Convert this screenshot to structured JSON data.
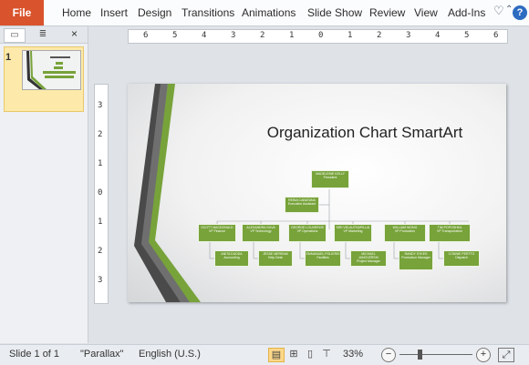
{
  "ribbon": {
    "file_label": "File",
    "tabs": [
      "Home",
      "Insert",
      "Design",
      "Transitions",
      "Animations",
      "Slide Show",
      "Review",
      "View",
      "Add-Ins"
    ],
    "icons": [
      "heart-icon",
      "chevron-up-icon",
      "help-icon"
    ],
    "help_label": "?"
  },
  "left_pane": {
    "tab_icons": [
      "slides-tab-icon",
      "outline-tab-icon"
    ],
    "close_label": "×",
    "thumbnail_number": "1"
  },
  "ruler": {
    "horizontal_labels": [
      "6",
      "5",
      "4",
      "3",
      "2",
      "1",
      "0",
      "1",
      "2",
      "3",
      "4",
      "5",
      "6"
    ],
    "vertical_labels": [
      "3",
      "2",
      "1",
      "0",
      "1",
      "2",
      "3"
    ]
  },
  "slide": {
    "title": "Organization Chart SmartArt",
    "accent_color": "#77a33a",
    "org_chart": {
      "president": {
        "name": "MADELEINE KELLY",
        "role": "President"
      },
      "assistant": {
        "name": "REINA CABATANA",
        "role": "Executive Assistant"
      },
      "vps": [
        {
          "name": "SCOTT MACDONALD",
          "role": "VP Finance"
        },
        {
          "name": "ALEXANDRA SILVA",
          "role": "VP Technology"
        },
        {
          "name": "GEORGE LOUVEROS",
          "role": "VP Operations"
        },
        {
          "name": "SIRI VELAUTHAPILLAI",
          "role": "VP Marketing"
        },
        {
          "name": "WILLIAM WONG",
          "role": "VP Production"
        },
        {
          "name": "TIM POPOSHKA",
          "role": "VP Transportation"
        }
      ],
      "staff": [
        {
          "name": "ANITA DUDDA",
          "role": "Accounting"
        },
        {
          "name": "JESSE MERRAM",
          "role": "Help Desk"
        },
        {
          "name": "EMMANUEL POLIERIS",
          "role": "Facilities"
        },
        {
          "name": "MICHAEL JANOVERSKI",
          "role": "Project Manager"
        },
        {
          "name": "RANDY SYKES",
          "role": "Production Manager"
        },
        {
          "name": "CONNIE PERTTO",
          "role": "Dispatch"
        }
      ]
    }
  },
  "status": {
    "slide_info": "Slide 1 of 1",
    "theme": "\"Parallax\"",
    "language": "English (U.S.)",
    "zoom": "33%",
    "zoom_minus": "−",
    "zoom_plus": "+",
    "zoom_level": 0.33
  }
}
